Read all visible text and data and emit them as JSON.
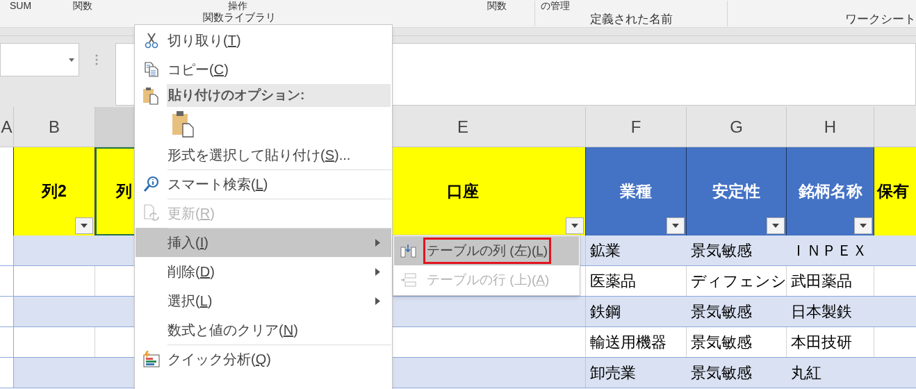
{
  "ribbon": {
    "top_labels": [
      {
        "text": "SUM"
      },
      {
        "text": "関数"
      },
      {
        "text": "操作"
      },
      {
        "text": "関数"
      },
      {
        "text": "の管理"
      }
    ],
    "groups": [
      "関数ライブラリ",
      "定義された名前",
      "ワークシート"
    ]
  },
  "columns": [
    {
      "letter": "A",
      "selected": false,
      "filter": false
    },
    {
      "letter": "B",
      "selected": false,
      "title": "列2",
      "color": "#ffff00",
      "filter": true
    },
    {
      "selected": true,
      "title": "列",
      "color": "#ffff00",
      "filter": false
    },
    {
      "letter": "E",
      "selected": false,
      "title": "口座",
      "color": "#ffff00",
      "filter": true
    },
    {
      "letter": "F",
      "selected": false,
      "title": "業種",
      "color": "#4472c4",
      "filter": true
    },
    {
      "letter": "G",
      "selected": false,
      "title": "安定性",
      "color": "#4472c4",
      "filter": true
    },
    {
      "letter": "H",
      "selected": false,
      "title": "銘柄名称",
      "color": "#4472c4",
      "filter": true
    },
    {
      "selected": false,
      "title": "保有",
      "color": "#ffff00",
      "filter": false
    }
  ],
  "rows": [
    {
      "cells": [
        "鉱業",
        "景気敏感",
        "ＩＮＰＥＸ"
      ]
    },
    {
      "cells": [
        "医薬品",
        "ディフェンシ",
        "武田薬品"
      ]
    },
    {
      "cells": [
        "鉄鋼",
        "景気敏感",
        "日本製鉄"
      ]
    },
    {
      "cells": [
        "輸送用機器",
        "景気敏感",
        "本田技研"
      ]
    },
    {
      "cells": [
        "卸売業",
        "景気敏感",
        "丸紅"
      ]
    }
  ],
  "context_menu": [
    {
      "kind": "command",
      "text": "切り取り(",
      "accelerator": "T",
      "suffix": ")",
      "disabled": false,
      "selected": false,
      "submenu": false,
      "divider_before": false
    },
    {
      "kind": "command",
      "text": "コピー(",
      "accelerator": "C",
      "suffix": ")",
      "disabled": false,
      "selected": false,
      "submenu": false,
      "divider_before": false
    },
    {
      "kind": "heading",
      "text": "貼り付けのオプション:"
    },
    {
      "kind": "paste_button"
    },
    {
      "kind": "command",
      "text": "形式を選択して貼り付け(",
      "accelerator": "S",
      "suffix": ")...",
      "disabled": false,
      "selected": false,
      "submenu": false,
      "divider_before": false
    },
    {
      "kind": "command",
      "text": "スマート検索(",
      "accelerator": "L",
      "suffix": ")",
      "disabled": false,
      "selected": false,
      "submenu": false,
      "divider_before": true
    },
    {
      "kind": "command",
      "text": "更新(",
      "accelerator": "R",
      "suffix": ")",
      "disabled": true,
      "selected": false,
      "submenu": false,
      "divider_before": true
    },
    {
      "kind": "command",
      "text": "挿入(",
      "accelerator": "I",
      "suffix": ")",
      "disabled": false,
      "selected": true,
      "submenu": true,
      "divider_before": true
    },
    {
      "kind": "command",
      "text": "削除(",
      "accelerator": "D",
      "suffix": ")",
      "disabled": false,
      "selected": false,
      "submenu": true,
      "divider_before": false
    },
    {
      "kind": "command",
      "text": "選択(",
      "accelerator": "L",
      "suffix": ")",
      "disabled": false,
      "selected": false,
      "submenu": true,
      "divider_before": false
    },
    {
      "kind": "command",
      "text": "数式と値のクリア(",
      "accelerator": "N",
      "suffix": ")",
      "disabled": false,
      "selected": false,
      "submenu": false,
      "divider_before": false
    },
    {
      "kind": "command",
      "text": "クイック分析(",
      "accelerator": "Q",
      "suffix": ")",
      "disabled": false,
      "selected": false,
      "submenu": false,
      "divider_before": true
    }
  ],
  "submenu": [
    {
      "text": "テーブルの列 (左)(",
      "accelerator": "L",
      "suffix": ")",
      "selected": true,
      "disabled": false,
      "outlined": true
    },
    {
      "text": "テーブルの行 (上)(",
      "accelerator": "A",
      "suffix": ")",
      "selected": false,
      "disabled": true,
      "outlined": false
    }
  ]
}
